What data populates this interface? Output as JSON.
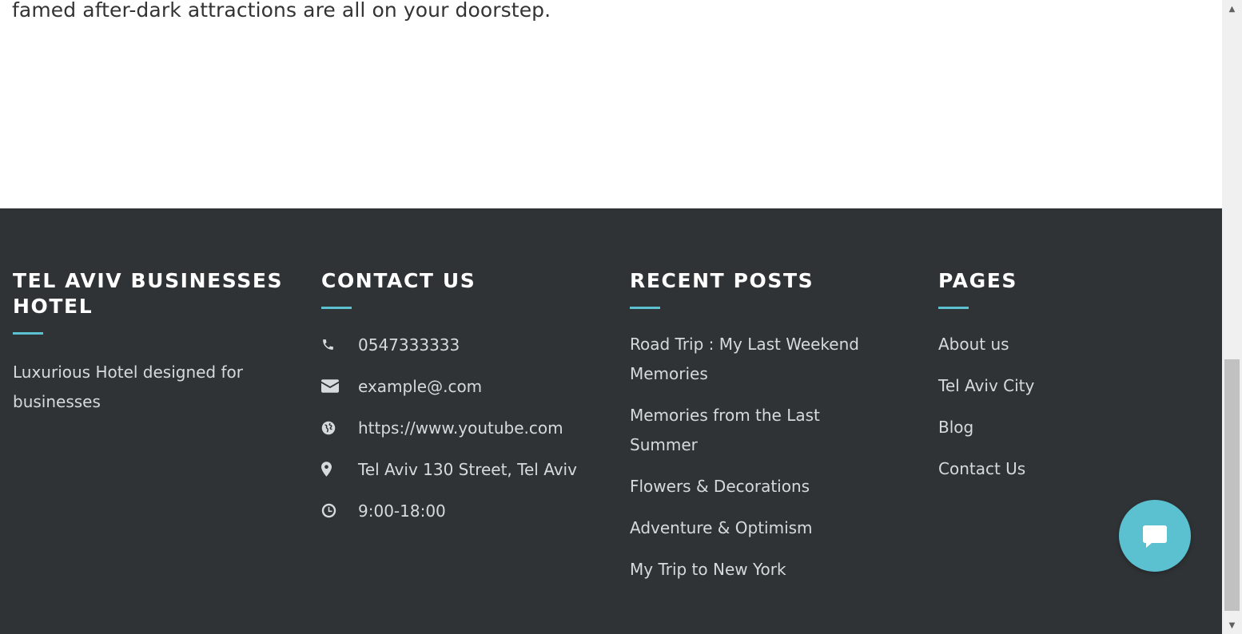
{
  "intro": {
    "text": "famed after-dark attractions are all on your doorstep."
  },
  "footer": {
    "about": {
      "title": "TEL AVIV BUSINESSES HOTEL",
      "description": "Luxurious Hotel designed for businesses"
    },
    "contact": {
      "title": "CONTACT US",
      "items": [
        {
          "icon": "phone-icon",
          "text": "0547333333"
        },
        {
          "icon": "envelope-icon",
          "text": "example@.com"
        },
        {
          "icon": "globe-icon",
          "text": "https://www.youtube.com"
        },
        {
          "icon": "map-marker-icon",
          "text": "Tel Aviv 130 Street, Tel Aviv"
        },
        {
          "icon": "clock-icon",
          "text": "9:00-18:00"
        }
      ]
    },
    "recent_posts": {
      "title": "RECENT POSTS",
      "items": [
        "Road Trip : My Last Weekend Memories",
        "Memories from the Last Summer",
        "Flowers & Decorations",
        "Adventure & Optimism",
        "My Trip to New York"
      ]
    },
    "pages": {
      "title": "PAGES",
      "items": [
        "About us",
        "Tel Aviv City",
        "Blog",
        "Contact Us"
      ]
    }
  },
  "colors": {
    "footer_bg": "#2f3336",
    "accent": "#5bc0cf",
    "footer_text": "#d7dadc"
  },
  "chat": {
    "icon": "chat-bubble-icon"
  }
}
